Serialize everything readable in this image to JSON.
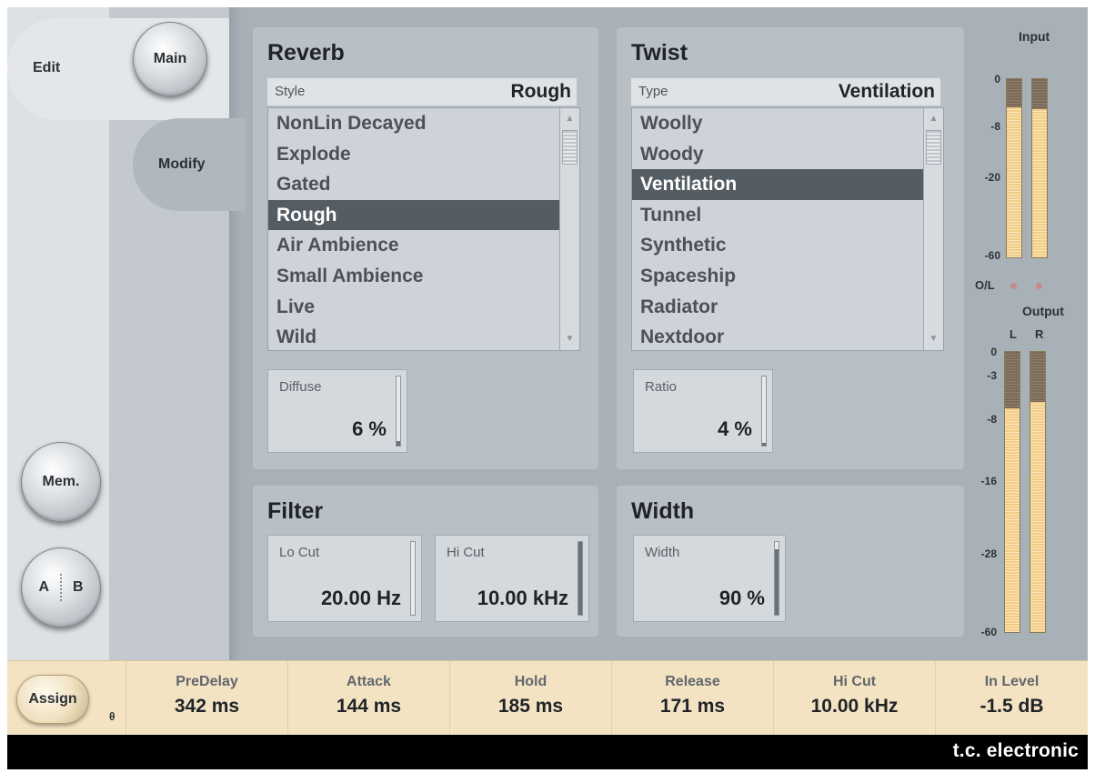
{
  "nav": {
    "edit_tab": "Edit",
    "main_button": "Main",
    "modify_tab": "Modify",
    "mem_button": "Mem.",
    "ab_a": "A",
    "ab_b": "B"
  },
  "reverb": {
    "title": "Reverb",
    "style_label": "Style",
    "style_value": "Rough",
    "items": [
      "NonLin Decayed",
      "Explode",
      "Gated",
      "Rough",
      "Air Ambience",
      "Small Ambience",
      "Live",
      "Wild"
    ],
    "selected": "Rough",
    "diffuse": {
      "label": "Diffuse",
      "value": "6 %",
      "level": 0.06
    }
  },
  "twist": {
    "title": "Twist",
    "type_label": "Type",
    "type_value": "Ventilation",
    "items": [
      "Woolly",
      "Woody",
      "Ventilation",
      "Tunnel",
      "Synthetic",
      "Spaceship",
      "Radiator",
      "Nextdoor"
    ],
    "selected": "Ventilation",
    "ratio": {
      "label": "Ratio",
      "value": "4 %",
      "level": 0.04
    }
  },
  "filter": {
    "title": "Filter",
    "lo_cut": {
      "label": "Lo Cut",
      "value": "20.00 Hz",
      "level": 0.0
    },
    "hi_cut": {
      "label": "Hi Cut",
      "value": "10.00 kHz",
      "level": 1.0
    }
  },
  "width": {
    "title": "Width",
    "width": {
      "label": "Width",
      "value": "90 %",
      "level": 0.9
    }
  },
  "meters": {
    "input_title": "Input",
    "output_title": "Output",
    "ol_label": "O/L",
    "l_label": "L",
    "r_label": "R",
    "input_scale": [
      "0",
      "-8",
      "-20",
      "-60"
    ],
    "output_scale": [
      "0",
      "-3",
      "-8",
      "-16",
      "-28",
      "-60"
    ],
    "input_levels": [
      0.84,
      0.83
    ],
    "output_levels": [
      0.8,
      0.82
    ],
    "fill_color": "#f2cd85"
  },
  "bottom": {
    "assign_button": "Assign",
    "lock_icon": "lock-icon",
    "params": [
      {
        "label": "PreDelay",
        "value": "342 ms"
      },
      {
        "label": "Attack",
        "value": "144 ms"
      },
      {
        "label": "Hold",
        "value": "185 ms"
      },
      {
        "label": "Release",
        "value": "171 ms"
      },
      {
        "label": "Hi Cut",
        "value": "10.00 kHz"
      },
      {
        "label": "In Level",
        "value": "-1.5 dB"
      }
    ]
  },
  "brand": "t.c. electronic"
}
